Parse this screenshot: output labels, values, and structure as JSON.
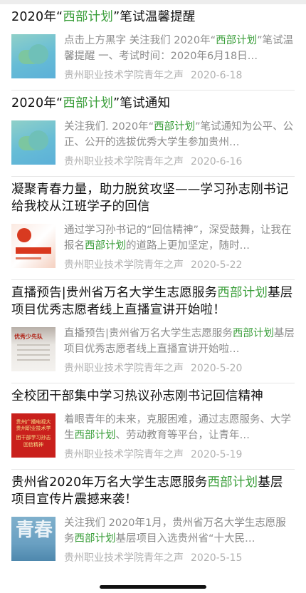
{
  "articles": [
    {
      "title_parts": [
        "2020年“",
        "西部计划",
        "”笔试温馨提醒"
      ],
      "summary_parts": [
        "点击上方黑字 关注我们 2020年“",
        "西部计划",
        "”笔试温馨提醒 一、考试时间：2020年6月18日…"
      ],
      "source": "贵州职业技术学院青年之声",
      "date": "2020-6-18",
      "thumb_icon": "cloud-thumbnail"
    },
    {
      "title_parts": [
        "2020年“",
        "西部计划",
        "”笔试通知"
      ],
      "summary_parts": [
        "关注我们. 2020年“",
        "西部计划",
        "”笔试通知为公平、公正、公开的选拔优秀大学生参加贵州…"
      ],
      "source": "贵州职业技术学院青年之声",
      "date": "2020-6-16",
      "thumb_icon": "cloud-thumbnail"
    },
    {
      "title_parts": [
        "凝聚青春力量，助力脱贫攻坚——学习孙志刚书记给我校从江班学子的回信",
        "",
        ""
      ],
      "summary_parts": [
        "通过学习孙书记的“回信精神”，深受鼓舞，让我在报名",
        "西部计划",
        "的道路上更加坚定，随时…"
      ],
      "source": "贵州职业技术学院青年之声",
      "date": "2020-5-22",
      "thumb_icon": "poverty-alleviation-thumbnail",
      "thumb_text": "助力脱贫攻坚"
    },
    {
      "title_parts": [
        "直播预告|贵州省万名大学生志愿服务",
        "西部计划",
        "基层项目优秀志愿者线上直播宣讲开始啦！"
      ],
      "summary_parts": [
        "直播预告|贵州省万名大学生志愿服务",
        "西部计划",
        "基层项目优秀志愿者线上直播宣讲开始啦…"
      ],
      "source": "贵州职业技术学院青年之声",
      "date": "2020-5-20",
      "thumb_icon": "volunteer-board-thumbnail",
      "thumb_text": "优秀少先队"
    },
    {
      "title_parts": [
        "全校团干部集中学习热议孙志刚书记回信精神",
        "",
        ""
      ],
      "summary_parts": [
        "着眼青年的未来，克服困难，通过志愿服务、大学生",
        "西部计划",
        "、劳动教育等平台，让青年…"
      ],
      "source": "贵州职业技术学院青年之声",
      "date": "2020-5-19",
      "thumb_icon": "red-banner-thumbnail",
      "thumb_lines": [
        "贵州广播电视大",
        "贵州职业技术学",
        "团干部学习孙志",
        "回信精神"
      ]
    },
    {
      "title_parts": [
        "贵州省2020年万名大学生志愿服务",
        "西部计划",
        "基层项目宣传片震撼来袭！"
      ],
      "summary_parts": [
        "关注我们 2020年1月，贵州省万名大学生志愿服务",
        "西部计划",
        "基层项目入选贵州省“十大民…"
      ],
      "source": "贵州职业技术学院青年之声",
      "date": "2020-5-15",
      "thumb_icon": "youth-spring-thumbnail",
      "thumb_text": "青春"
    }
  ]
}
